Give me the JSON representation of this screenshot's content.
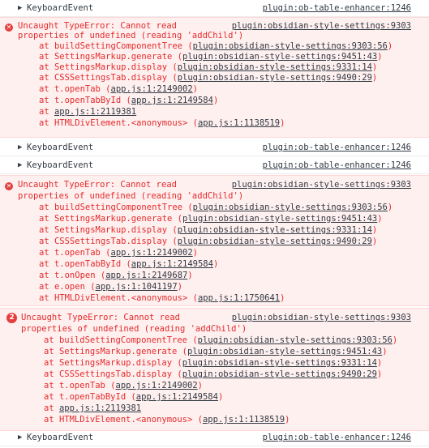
{
  "entries": [
    {
      "type": "log",
      "arrow": "▶",
      "message": "KeyboardEvent",
      "source": "plugin:ob-table-enhancer:1246"
    },
    {
      "type": "error",
      "icon": "✕",
      "message_l1": "Uncaught TypeError: Cannot read",
      "message_l2": "properties of undefined (reading 'addChild')",
      "source": "plugin:obsidian-style-settings:9303",
      "frames": [
        {
          "prefix": "at buildSettingComponentTree (",
          "link": "plugin:obsidian-style-settings:9303:56",
          "suffix": ")"
        },
        {
          "prefix": "at SettingsMarkup.generate (",
          "link": "plugin:obsidian-style-settings:9451:43",
          "suffix": ")"
        },
        {
          "prefix": "at SettingsMarkup.display (",
          "link": "plugin:obsidian-style-settings:9331:14",
          "suffix": ")"
        },
        {
          "prefix": "at CSSSettingsTab.display (",
          "link": "plugin:obsidian-style-settings:9490:29",
          "suffix": ")"
        },
        {
          "prefix": "at t.openTab (",
          "link": "app.js:1:2149002",
          "suffix": ")"
        },
        {
          "prefix": "at t.openTabById (",
          "link": "app.js:1:2149584",
          "suffix": ")"
        },
        {
          "prefix": "at ",
          "link": "app.js:1:2119381",
          "suffix": ""
        },
        {
          "prefix": "at HTMLDivElement.<anonymous> (",
          "link": "app.js:1:1138519",
          "suffix": ")"
        }
      ]
    },
    {
      "type": "log",
      "arrow": "▶",
      "message": "KeyboardEvent",
      "source": "plugin:ob-table-enhancer:1246"
    },
    {
      "type": "log",
      "arrow": "▶",
      "message": "KeyboardEvent",
      "source": "plugin:ob-table-enhancer:1246"
    },
    {
      "type": "error",
      "icon": "✕",
      "message_l1": "Uncaught TypeError: Cannot read",
      "message_l2": "properties of undefined (reading 'addChild')",
      "source": "plugin:obsidian-style-settings:9303",
      "frames": [
        {
          "prefix": "at buildSettingComponentTree (",
          "link": "plugin:obsidian-style-settings:9303:56",
          "suffix": ")"
        },
        {
          "prefix": "at SettingsMarkup.generate (",
          "link": "plugin:obsidian-style-settings:9451:43",
          "suffix": ")"
        },
        {
          "prefix": "at SettingsMarkup.display (",
          "link": "plugin:obsidian-style-settings:9331:14",
          "suffix": ")"
        },
        {
          "prefix": "at CSSSettingsTab.display (",
          "link": "plugin:obsidian-style-settings:9490:29",
          "suffix": ")"
        },
        {
          "prefix": "at t.openTab (",
          "link": "app.js:1:2149002",
          "suffix": ")"
        },
        {
          "prefix": "at t.openTabById (",
          "link": "app.js:1:2149584",
          "suffix": ")"
        },
        {
          "prefix": "at t.onOpen (",
          "link": "app.js:1:2149687",
          "suffix": ")"
        },
        {
          "prefix": "at e.open (",
          "link": "app.js:1:1041197",
          "suffix": ")"
        },
        {
          "prefix": "at HTMLDivElement.<anonymous> (",
          "link": "app.js:1:1750641",
          "suffix": ")"
        }
      ]
    },
    {
      "type": "error",
      "icon": "2",
      "message_l1": "Uncaught TypeError: Cannot read",
      "message_l2": "properties of undefined (reading 'addChild')",
      "source": "plugin:obsidian-style-settings:9303",
      "frames": [
        {
          "prefix": "at buildSettingComponentTree (",
          "link": "plugin:obsidian-style-settings:9303:56",
          "suffix": ")"
        },
        {
          "prefix": "at SettingsMarkup.generate (",
          "link": "plugin:obsidian-style-settings:9451:43",
          "suffix": ")"
        },
        {
          "prefix": "at SettingsMarkup.display (",
          "link": "plugin:obsidian-style-settings:9331:14",
          "suffix": ")"
        },
        {
          "prefix": "at CSSSettingsTab.display (",
          "link": "plugin:obsidian-style-settings:9490:29",
          "suffix": ")"
        },
        {
          "prefix": "at t.openTab (",
          "link": "app.js:1:2149002",
          "suffix": ")"
        },
        {
          "prefix": "at t.openTabById (",
          "link": "app.js:1:2149584",
          "suffix": ")"
        },
        {
          "prefix": "at ",
          "link": "app.js:1:2119381",
          "suffix": ""
        },
        {
          "prefix": "at HTMLDivElement.<anonymous> (",
          "link": "app.js:1:1138519",
          "suffix": ")"
        }
      ]
    },
    {
      "type": "log",
      "arrow": "▶",
      "message": "KeyboardEvent",
      "source": "plugin:ob-table-enhancer:1246"
    }
  ]
}
